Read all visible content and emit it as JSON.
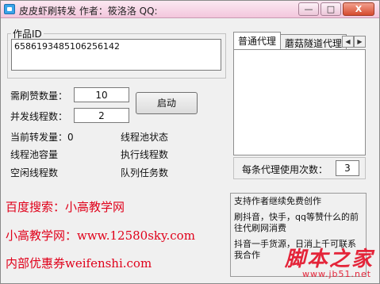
{
  "window": {
    "title": "皮皮虾刷转发 作者：筱洛洛 QQ:",
    "min_label": "—",
    "max_label": "□",
    "close_label": "X"
  },
  "works": {
    "group_label": "作品ID",
    "id_value": "6586193485106256142"
  },
  "form": {
    "required_count_label": "需刷赞数量：",
    "required_count_value": "10",
    "threads_label": "并发线程数：",
    "threads_value": "2",
    "start_button": "启动"
  },
  "stats": {
    "current_forward": "当前转发量：0",
    "pool_capacity": "线程池容量",
    "idle_threads": "空闲线程数",
    "pool_status": "线程池状态",
    "executing_threads": "执行线程数",
    "queue_tasks": "队列任务数"
  },
  "proxy": {
    "tabs": [
      {
        "label": "普通代理",
        "active": true
      },
      {
        "label": "蘑菇隧道代理",
        "active": false
      }
    ],
    "arrow_left": "◀",
    "arrow_right": "▶",
    "per_proxy_label": "每条代理使用次数：",
    "per_proxy_value": "3"
  },
  "ads": {
    "line1": "百度搜索：小高教学网",
    "line2": "小高教学网：www.12580sky.com",
    "line3": "内部优惠券weifenshi.com"
  },
  "info": {
    "p1": "支持作者继续免费创作",
    "p2": "刷抖音，快手，qq等赞什么的前往代刷网消费",
    "p3": "抖音一手货源，日消上千可联系我合作"
  },
  "watermark": {
    "title": "脚本之家",
    "url": "www.jb51.net"
  },
  "colors": {
    "ad_red": "#e0001a",
    "title_bar_pink": "#f3c6dc"
  }
}
